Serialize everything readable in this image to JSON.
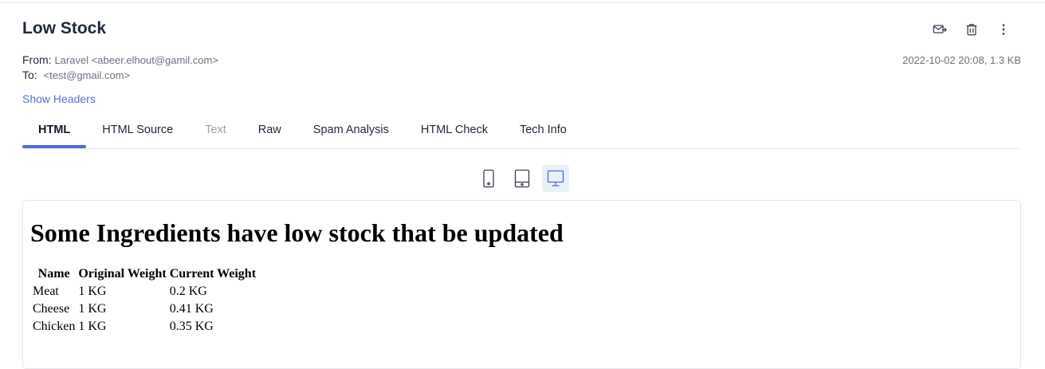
{
  "message": {
    "subject": "Low Stock",
    "from_label": "From:",
    "from_value": "Laravel <abeer.elhout@gamil.com>",
    "to_label": "To:",
    "to_value": "<test@gmail.com>",
    "date_size": "2022-10-02 20:08, 1.3 KB",
    "show_headers": "Show Headers"
  },
  "tabs": [
    {
      "label": "HTML",
      "state": "active"
    },
    {
      "label": "HTML Source",
      "state": "normal"
    },
    {
      "label": "Text",
      "state": "disabled"
    },
    {
      "label": "Raw",
      "state": "normal"
    },
    {
      "label": "Spam Analysis",
      "state": "normal"
    },
    {
      "label": "HTML Check",
      "state": "normal"
    },
    {
      "label": "Tech Info",
      "state": "normal"
    }
  ],
  "actions": [
    {
      "icon": "release-mail-icon"
    },
    {
      "icon": "trash-icon"
    },
    {
      "icon": "more-vertical-icon"
    }
  ],
  "devices": [
    {
      "icon": "phone-icon",
      "active": false
    },
    {
      "icon": "tablet-icon",
      "active": false
    },
    {
      "icon": "desktop-icon",
      "active": true
    }
  ],
  "preview": {
    "heading": "Some Ingredients have low stock that be updated",
    "columns": [
      "Name",
      "Original Weight",
      "Current Weight"
    ],
    "rows": [
      [
        "Meat",
        "1 KG",
        "0.2 KG"
      ],
      [
        "Cheese",
        "1 KG",
        "0.41 KG"
      ],
      [
        "Chicken",
        "1 KG",
        "0.35 KG"
      ]
    ]
  },
  "colors": {
    "accent": "#4f6ae0",
    "link": "#5b6dd8",
    "muted": "#6b7280",
    "active_device_bg": "#e8f0f8"
  }
}
